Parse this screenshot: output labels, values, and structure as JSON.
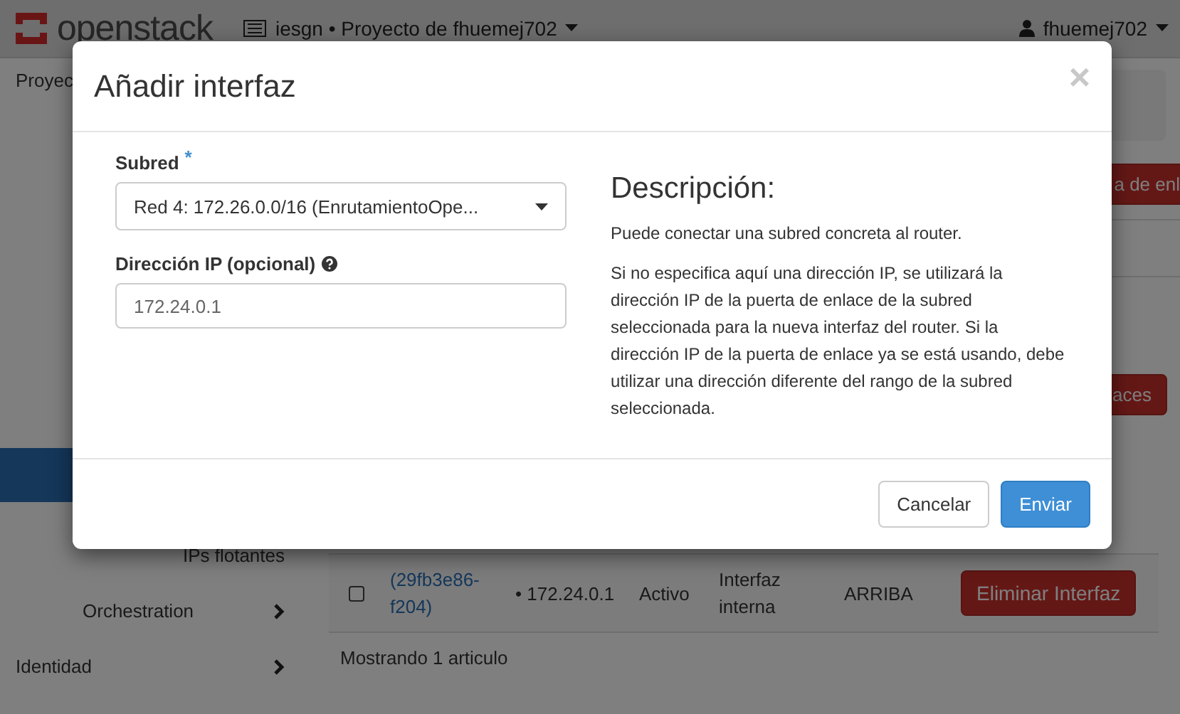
{
  "navbar": {
    "brand": "openstack",
    "project": "iesgn • Proyecto de fhuemej702",
    "user": "fhuemej702"
  },
  "breadcrumb": "Proyec",
  "sidebar": {
    "items": [
      {
        "label": "IPs flotantes",
        "kind": "link"
      },
      {
        "label": "Orchestration",
        "kind": "group"
      },
      {
        "label": "Identidad",
        "kind": "group"
      }
    ]
  },
  "page_buttons": [
    "a de enl",
    "aces"
  ],
  "table": {
    "rows": [
      {
        "name": "(29fb3e86-f204)",
        "ip": "• 172.24.0.1",
        "status": "Activo",
        "type": "Interfaz interna",
        "admin_state": "ARRIBA",
        "action": "Eliminar Interfaz",
        "checked": false
      }
    ],
    "footer": "Mostrando 1 articulo"
  },
  "modal": {
    "title": "Añadir interfaz",
    "close": "×",
    "subnet": {
      "label": "Subred",
      "required": "*",
      "value": "Red 4: 172.26.0.0/16 (EnrutamientoOpe..."
    },
    "ip": {
      "label": "Dirección IP (opcional)",
      "placeholder": "172.24.0.1"
    },
    "description": {
      "title": "Descripción:",
      "paragraphs": [
        "Puede conectar una subred concreta al router.",
        "Si no especifica aquí una dirección IP, se utilizará la dirección IP de la puerta de enlace de la subred seleccionada para la nueva interfaz del router. Si la dirección IP de la puerta de enlace ya se está usando, debe utilizar una dirección diferente del rango de la subred seleccionada."
      ]
    },
    "buttons": [
      {
        "label": "Cancelar",
        "kind": "default"
      },
      {
        "label": "Enviar",
        "kind": "primary"
      }
    ]
  }
}
